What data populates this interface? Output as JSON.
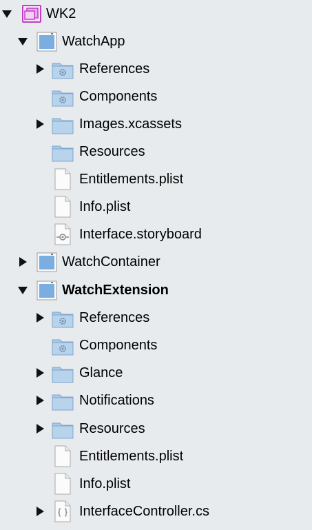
{
  "tree": {
    "root": {
      "label": "WK2",
      "expanded": true,
      "icon": "solution-icon"
    },
    "watchapp": {
      "label": "WatchApp",
      "expanded": true,
      "icon": "project-icon",
      "children": {
        "references": {
          "label": "References",
          "icon": "gear-folder-icon",
          "expandable": true
        },
        "components": {
          "label": "Components",
          "icon": "gear-folder-icon"
        },
        "images": {
          "label": "Images.xcassets",
          "icon": "folder-icon",
          "expandable": true
        },
        "resources": {
          "label": "Resources",
          "icon": "folder-icon"
        },
        "entitlements": {
          "label": "Entitlements.plist",
          "icon": "file-icon"
        },
        "info": {
          "label": "Info.plist",
          "icon": "file-icon"
        },
        "storyboard": {
          "label": "Interface.storyboard",
          "icon": "storyboard-file-icon"
        }
      }
    },
    "watchcontainer": {
      "label": "WatchContainer",
      "expanded": false,
      "icon": "project-icon"
    },
    "watchextension": {
      "label": "WatchExtension",
      "expanded": true,
      "bold": true,
      "icon": "project-icon",
      "children": {
        "references": {
          "label": "References",
          "icon": "gear-folder-icon",
          "expandable": true
        },
        "components": {
          "label": "Components",
          "icon": "gear-folder-icon"
        },
        "glance": {
          "label": "Glance",
          "icon": "folder-icon",
          "expandable": true
        },
        "notifications": {
          "label": "Notifications",
          "icon": "folder-icon",
          "expandable": true
        },
        "resources": {
          "label": "Resources",
          "icon": "folder-icon",
          "expandable": true
        },
        "entitlements": {
          "label": "Entitlements.plist",
          "icon": "file-icon"
        },
        "info": {
          "label": "Info.plist",
          "icon": "file-icon"
        },
        "controller": {
          "label": "InterfaceController.cs",
          "icon": "csharp-file-icon",
          "expandable": true
        }
      }
    }
  },
  "colors": {
    "background": "#e8ebee",
    "solution_purple": "#c13fc7",
    "project_blue": "#7aaee0",
    "folder_blue": "#a9c9e6"
  }
}
